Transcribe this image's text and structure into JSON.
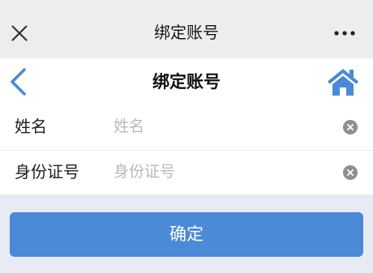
{
  "window": {
    "title": "绑定账号",
    "close_icon": "close-icon",
    "more_icon": "more-icon"
  },
  "header": {
    "title": "绑定账号",
    "back_icon": "chevron-left-icon",
    "home_icon": "home-icon"
  },
  "form": {
    "fields": [
      {
        "label": "姓名",
        "value": "",
        "placeholder": "姓名",
        "clear_icon": "clear-icon"
      },
      {
        "label": "身份证号",
        "value": "",
        "placeholder": "身份证号",
        "clear_icon": "clear-icon"
      }
    ]
  },
  "submit": {
    "label": "确定"
  },
  "colors": {
    "accent": "#4a8ad6",
    "topbar_bg": "#ededed",
    "page_bg": "#e8ebf4",
    "placeholder": "#b9b9b9",
    "clear_icon": "#8f8f8f"
  }
}
